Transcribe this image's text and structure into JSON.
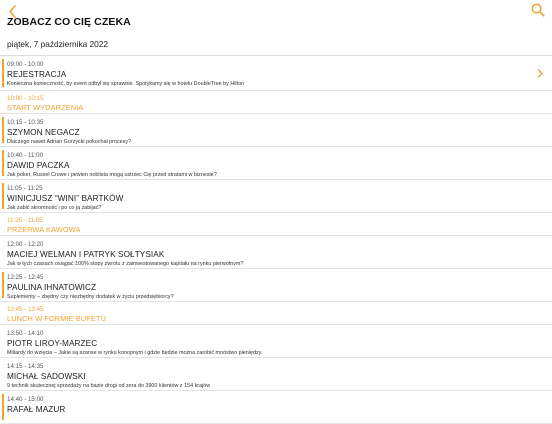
{
  "header": {
    "title": "ZOBACZ CO CIĘ CZEKA",
    "back_icon": "chevron-left-icon",
    "search_icon": "search-icon",
    "accent": "#f0a330"
  },
  "date_header": "piątek, 7 października 2022",
  "agenda": [
    {
      "type": "session",
      "time": "09:00 - 10:00",
      "title": "REJESTRACJA",
      "desc": "Konieczna konieczność, by event odbył się sprawnie. Spotykamy się w hotelu DoubleTree by Hilton",
      "chevron": true
    },
    {
      "type": "break",
      "time": "10:00 - 10:15",
      "title": "START WYDARZENIA"
    },
    {
      "type": "session",
      "time": "10:15 - 10:35",
      "title": "SZYMON NEGACZ",
      "desc": "Dlaczego nawet Adrian Gorzycki pokochał procesy?"
    },
    {
      "type": "session",
      "time": "10:40 - 11:00",
      "title": "DAWID PACZKA",
      "desc": "Jak poker, Russel Crowe i pewien noblista mogą ustrzec Cię przed stratami w biznesie?"
    },
    {
      "type": "session",
      "time": "11:05 - 11:25",
      "title": "WINICJUSZ “WINI” BARTKÓW",
      "desc": "Jak zabić skromność i po co ją zabijać?"
    },
    {
      "type": "break",
      "time": "11:25 - 11:55",
      "title": "PRZERWA KAWOWA"
    },
    {
      "type": "session",
      "time": "12:00 - 12:20",
      "title": "MACIEJ WELMAN I PATRYK SOŁTYSIAK",
      "desc": "Jak w tych czasach osiągać 100% stopy zwrotu z zainwestowanego kapitału na rynku pierwotnym?"
    },
    {
      "type": "session",
      "time": "12:25 - 12:45",
      "title": "PAULINA IHNATOWICZ",
      "desc": "Suplementy – zbędny czy niezbędny dodatek w życiu przedsiębiorcy?"
    },
    {
      "type": "break",
      "time": "12:45 - 13:45",
      "title": "LUNCH W FORMIE BUFETU"
    },
    {
      "type": "session",
      "time": "13:50 - 14:10",
      "title": "PIOTR LIROY-MARZEC",
      "desc": "Miliardy do wzięcia – Jakie są szanse w rynku konopnym i gdzie będzie można zarobić mnóstwo pieniędzy."
    },
    {
      "type": "session",
      "time": "14:15 - 14:35",
      "title": "MICHAŁ SADOWSKI",
      "desc": "9 technik skutecznej sprzedaży na bazie drogi od zera do 3900 klientów z 154 krajów"
    },
    {
      "type": "session",
      "time": "14:40 - 15:00",
      "title": "RAFAŁ MAZUR",
      "desc": ""
    }
  ]
}
